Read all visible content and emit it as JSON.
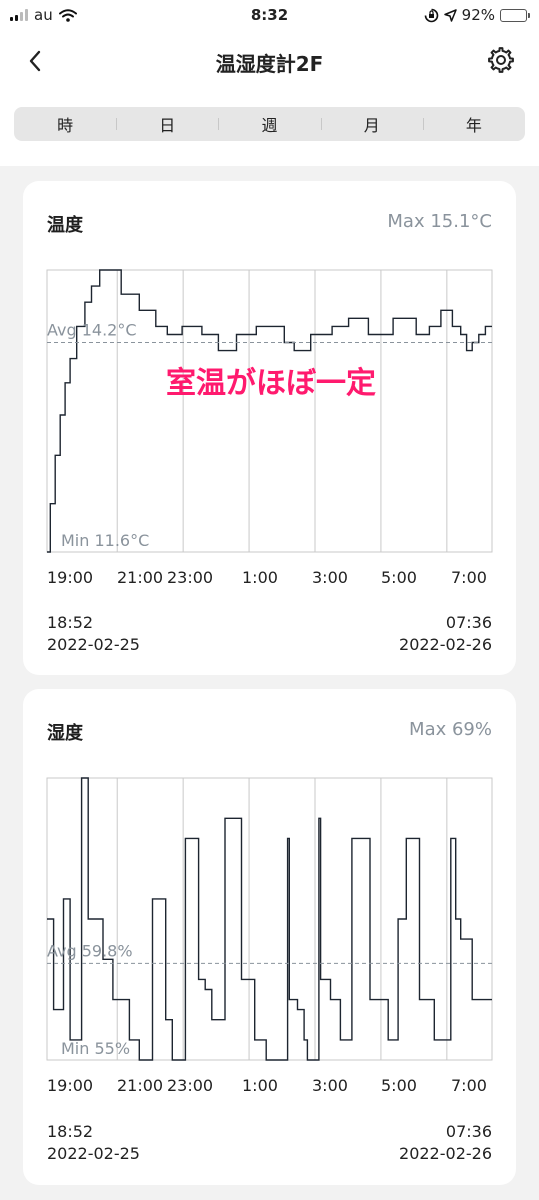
{
  "status_bar": {
    "carrier": "au",
    "time": "8:32",
    "battery_percent_text": "92%",
    "battery_level": 0.92
  },
  "header": {
    "title": "温湿度計2F"
  },
  "tabs": [
    "時",
    "日",
    "週",
    "月",
    "年"
  ],
  "colors": {
    "annotation": "#ff1a6e",
    "line": "#1d2530",
    "grid": "#c9c9c9",
    "avg_line": "#8a939c",
    "muted_text": "#8a939c"
  },
  "icons": [
    "back-chevron-icon",
    "gear-icon",
    "wifi-icon",
    "location-arrow-icon",
    "orientation-lock-icon",
    "battery-icon"
  ],
  "cards": [
    {
      "title": "温度",
      "max_text": "Max 15.1°C",
      "avg_text": "Avg 14.2°C",
      "min_text": "Min 11.6°C",
      "annotation": "室温がほぼ一定",
      "x_ticks": [
        "19:00",
        "21:00",
        "23:00",
        "1:00",
        "3:00",
        "5:00",
        "7:00"
      ],
      "start_time": "18:52",
      "start_date": "2022-02-25",
      "end_time": "07:36",
      "end_date": "2022-02-26"
    },
    {
      "title": "湿度",
      "max_text": "Max 69%",
      "avg_text": "Avg 59.8%",
      "min_text": "Min 55%",
      "x_ticks": [
        "19:00",
        "21:00",
        "23:00",
        "1:00",
        "3:00",
        "5:00",
        "7:00"
      ],
      "start_time": "18:52",
      "start_date": "2022-02-25",
      "end_time": "07:36",
      "end_date": "2022-02-26"
    }
  ],
  "chart_data": [
    {
      "type": "line",
      "title": "温度",
      "x_unit": "hours since 18:52",
      "x_ticks": [
        "19:00",
        "21:00",
        "23:00",
        "1:00",
        "3:00",
        "5:00",
        "7:00"
      ],
      "ylim": [
        11.6,
        15.1
      ],
      "max": 15.1,
      "avg": 14.2,
      "min": 11.6,
      "points": [
        [
          0.0,
          11.6
        ],
        [
          0.1,
          12.2
        ],
        [
          0.25,
          12.8
        ],
        [
          0.4,
          13.3
        ],
        [
          0.55,
          13.7
        ],
        [
          0.7,
          14.0
        ],
        [
          0.9,
          14.4
        ],
        [
          1.15,
          14.7
        ],
        [
          1.35,
          14.9
        ],
        [
          1.6,
          15.1
        ],
        [
          2.25,
          14.8
        ],
        [
          2.8,
          14.6
        ],
        [
          3.3,
          14.4
        ],
        [
          3.65,
          14.3
        ],
        [
          4.1,
          14.4
        ],
        [
          4.7,
          14.3
        ],
        [
          5.2,
          14.1
        ],
        [
          5.75,
          14.3
        ],
        [
          6.35,
          14.4
        ],
        [
          7.2,
          14.2
        ],
        [
          7.5,
          14.1
        ],
        [
          8.0,
          14.3
        ],
        [
          8.65,
          14.4
        ],
        [
          9.15,
          14.5
        ],
        [
          9.75,
          14.3
        ],
        [
          10.5,
          14.5
        ],
        [
          11.2,
          14.3
        ],
        [
          11.6,
          14.4
        ],
        [
          11.95,
          14.6
        ],
        [
          12.3,
          14.4
        ],
        [
          12.55,
          14.3
        ],
        [
          12.73,
          14.1
        ],
        [
          12.9,
          14.2
        ],
        [
          13.1,
          14.3
        ],
        [
          13.3,
          14.4
        ]
      ]
    },
    {
      "type": "line",
      "title": "湿度",
      "x_unit": "hours since 18:52",
      "x_ticks": [
        "19:00",
        "21:00",
        "23:00",
        "1:00",
        "3:00",
        "5:00",
        "7:00"
      ],
      "ylim": [
        55,
        69
      ],
      "max": 69,
      "avg": 59.8,
      "min": 55,
      "points": [
        [
          0.0,
          62
        ],
        [
          0.1,
          62
        ],
        [
          0.2,
          57.5
        ],
        [
          0.45,
          57.5
        ],
        [
          0.5,
          63
        ],
        [
          0.6,
          63
        ],
        [
          0.7,
          56
        ],
        [
          1.0,
          56
        ],
        [
          1.05,
          69
        ],
        [
          1.15,
          69
        ],
        [
          1.25,
          62
        ],
        [
          1.55,
          62
        ],
        [
          1.7,
          60
        ],
        [
          1.85,
          60
        ],
        [
          2.0,
          58
        ],
        [
          2.2,
          58
        ],
        [
          2.5,
          56
        ],
        [
          2.8,
          55
        ],
        [
          3.15,
          55
        ],
        [
          3.2,
          63
        ],
        [
          3.55,
          63
        ],
        [
          3.6,
          57
        ],
        [
          3.8,
          55
        ],
        [
          4.15,
          55
        ],
        [
          4.2,
          66
        ],
        [
          4.5,
          66
        ],
        [
          4.6,
          59
        ],
        [
          4.8,
          58.5
        ],
        [
          5.0,
          57
        ],
        [
          5.35,
          57
        ],
        [
          5.4,
          67
        ],
        [
          5.85,
          67
        ],
        [
          5.9,
          59
        ],
        [
          6.1,
          59
        ],
        [
          6.3,
          56
        ],
        [
          6.55,
          56
        ],
        [
          6.65,
          55
        ],
        [
          7.15,
          55
        ],
        [
          7.3,
          66
        ],
        [
          7.35,
          58
        ],
        [
          7.6,
          57.5
        ],
        [
          7.8,
          56
        ],
        [
          7.9,
          55
        ],
        [
          8.2,
          55
        ],
        [
          8.25,
          67
        ],
        [
          8.3,
          59
        ],
        [
          8.6,
          58
        ],
        [
          8.9,
          56
        ],
        [
          9.15,
          56
        ],
        [
          9.25,
          66
        ],
        [
          9.75,
          66
        ],
        [
          9.8,
          58
        ],
        [
          10.15,
          58
        ],
        [
          10.35,
          56
        ],
        [
          10.55,
          56
        ],
        [
          10.65,
          62
        ],
        [
          10.85,
          62
        ],
        [
          10.9,
          66
        ],
        [
          11.25,
          66
        ],
        [
          11.3,
          58
        ],
        [
          11.65,
          58
        ],
        [
          11.75,
          56
        ],
        [
          12.0,
          56
        ],
        [
          12.2,
          56
        ],
        [
          12.25,
          66
        ],
        [
          12.4,
          62
        ],
        [
          12.55,
          61
        ],
        [
          12.9,
          58
        ],
        [
          13.3,
          58
        ]
      ]
    }
  ]
}
